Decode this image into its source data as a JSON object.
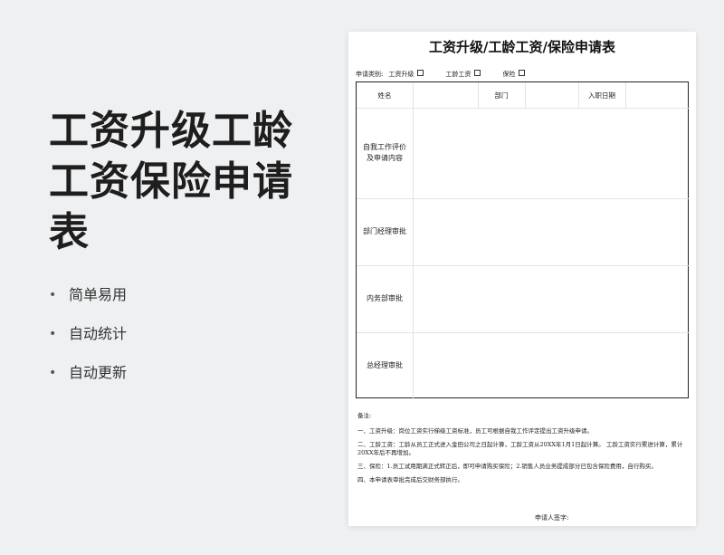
{
  "hero": {
    "title": "工资升级工龄工资保险申请表",
    "features": [
      "简单易用",
      "自动统计",
      "自动更新"
    ]
  },
  "sheet": {
    "title": "工资升级/工龄工资/保险申请表",
    "category_label": "申请类别:",
    "categories": [
      "工资升级",
      "工龄工资",
      "保险"
    ],
    "header": {
      "name": "姓名",
      "dept": "部门",
      "date": "入职日期"
    },
    "rows": [
      "自我工作评价\n及申请内容",
      "部门经理审批",
      "内务部审批",
      "总经理审批"
    ],
    "notes_title": "备注:",
    "notes": [
      "一、工资升级：岗位工资实行梯级工资标准，员工可根据自我工作评定提出工资升级申请。",
      "二、工龄工资：工龄从员工正式进入金田公司之日起计算，工龄工资从20XX年1月1日起计算。 工龄工资实行累进计算，累计20XX年后不再增加。",
      "三、保险：1.员工试用期满正式转正后，即可申请购买保险；2.销售人员业务提成部分已包含保险费用，自行购买。",
      "四、本申请表审批完成后交财务部执行。"
    ],
    "signature": "申请人签字:"
  }
}
